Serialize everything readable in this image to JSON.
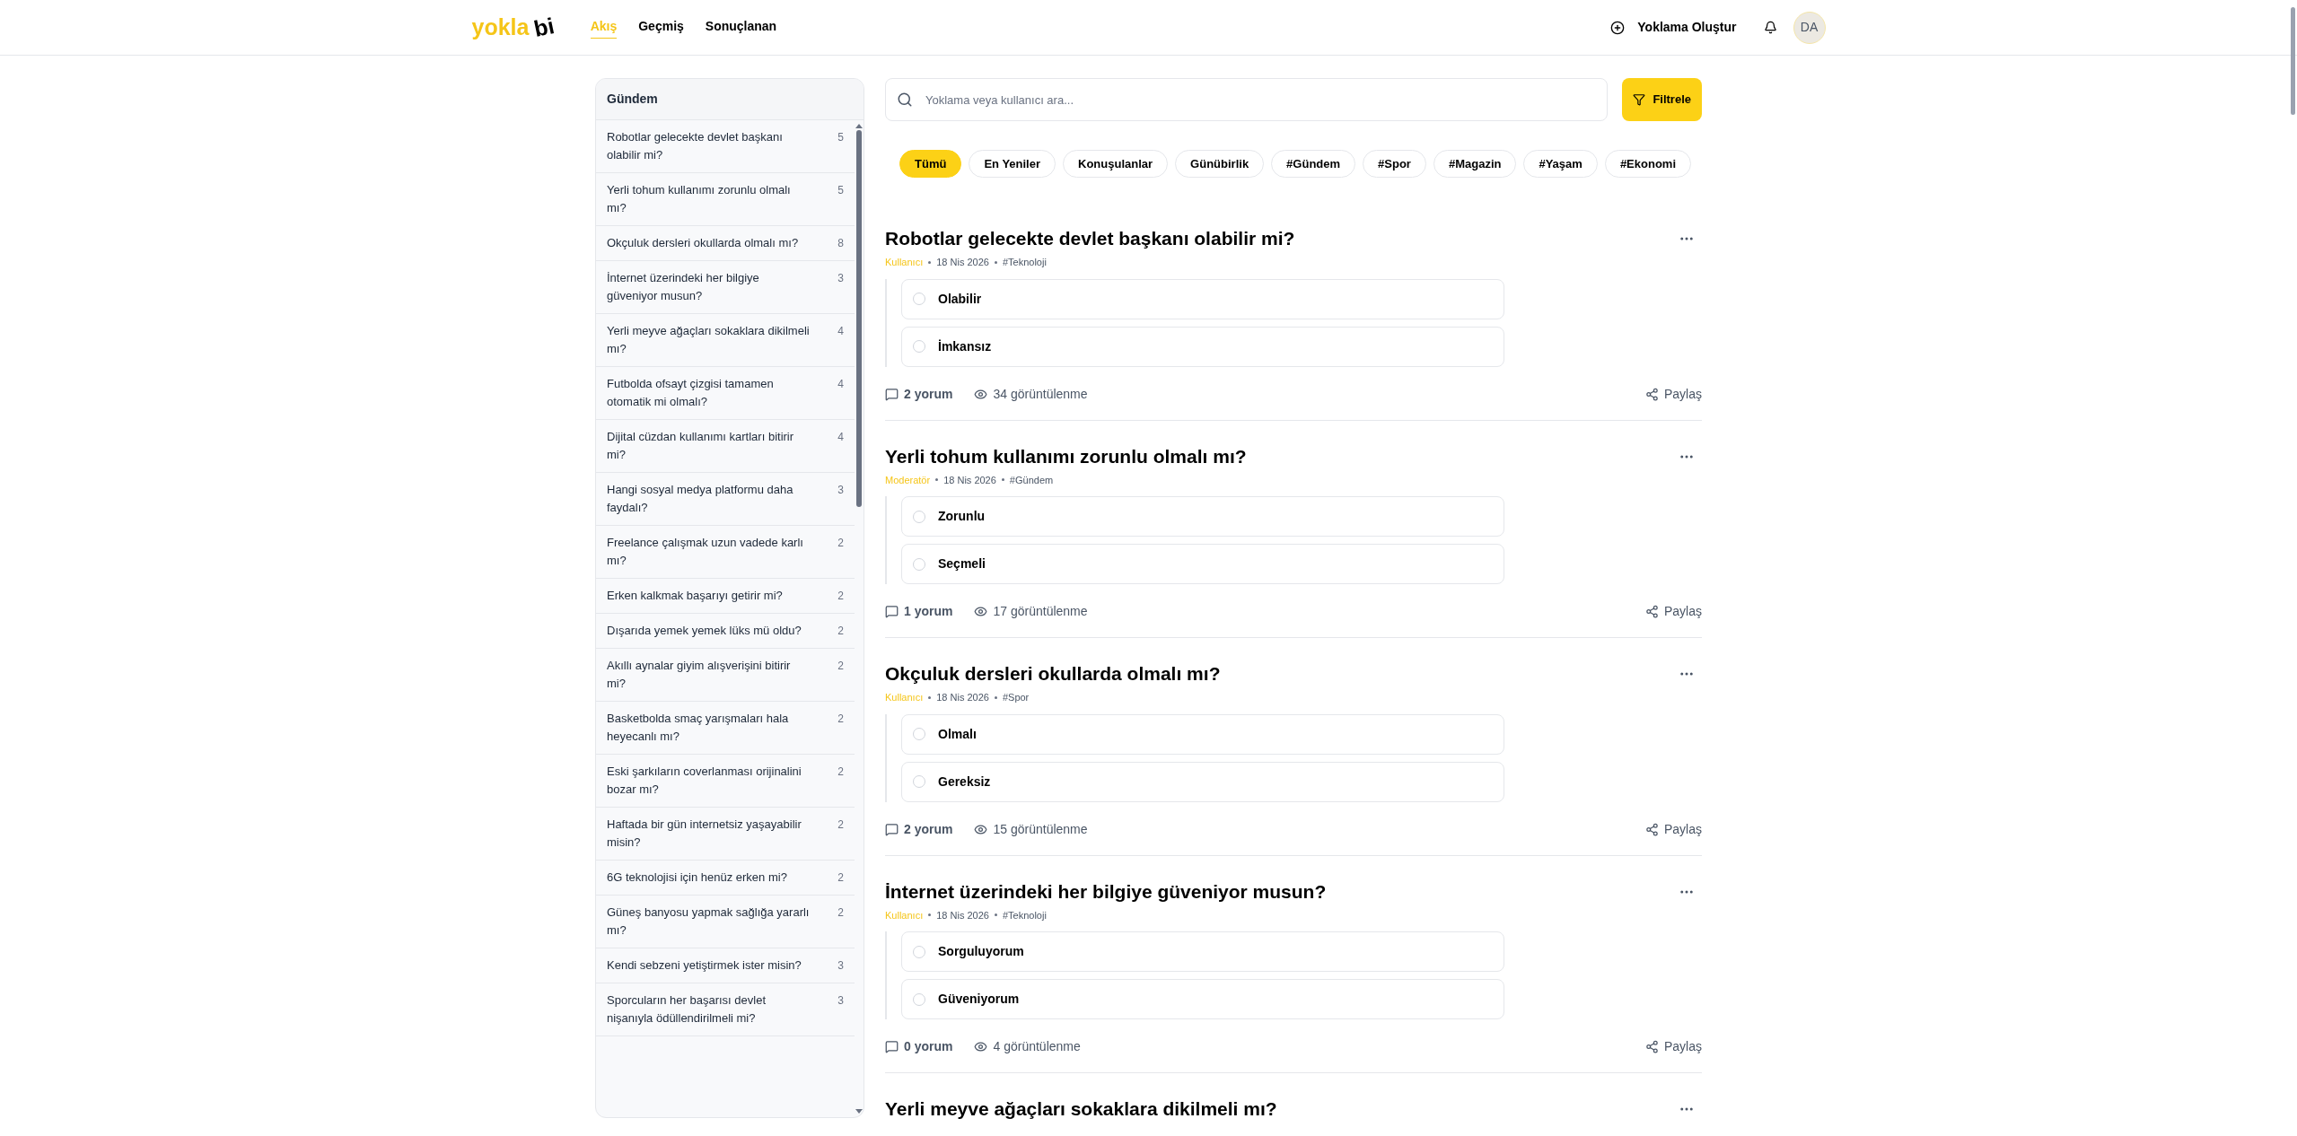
{
  "header": {
    "logo": {
      "part_1": "yokla",
      "part_2": "bi"
    },
    "nav": [
      {
        "label": "Akış",
        "selected": true
      },
      {
        "label": "Geçmiş",
        "selected": false
      },
      {
        "label": "Sonuçlanan",
        "selected": false
      }
    ],
    "create_button": "Yoklama Oluştur",
    "avatar": "DA"
  },
  "sidebar": {
    "title": "Gündem",
    "items": [
      {
        "text": "Robotlar gelecekte devlet başkanı olabilir mi?",
        "count": "5"
      },
      {
        "text": "Yerli tohum kullanımı zorunlu olmalı mı?",
        "count": "5"
      },
      {
        "text": "Okçuluk dersleri okullarda olmalı mı?",
        "count": "8"
      },
      {
        "text": "İnternet üzerindeki her bilgiye güveniyor musun?",
        "count": "3"
      },
      {
        "text": "Yerli meyve ağaçları sokaklara dikilmeli mı?",
        "count": "4"
      },
      {
        "text": "Futbolda ofsayt çizgisi tamamen otomatik mi olmalı?",
        "count": "4"
      },
      {
        "text": "Dijital cüzdan kullanımı kartları bitirir mi?",
        "count": "4"
      },
      {
        "text": "Hangi sosyal medya platformu daha faydalı?",
        "count": "3"
      },
      {
        "text": "Freelance çalışmak uzun vadede karlı mı?",
        "count": "2"
      },
      {
        "text": "Erken kalkmak başarıyı getirir mi?",
        "count": "2"
      },
      {
        "text": "Dışarıda yemek yemek lüks mü oldu?",
        "count": "2"
      },
      {
        "text": "Akıllı aynalar giyim alışverişini bitirir mi?",
        "count": "2"
      },
      {
        "text": "Basketbolda smaç yarışmaları hala heyecanlı mı?",
        "count": "2"
      },
      {
        "text": "Eski şarkıların coverlanması orijinalini bozar mı?",
        "count": "2"
      },
      {
        "text": "Haftada bir gün internetsiz yaşayabilir misin?",
        "count": "2"
      },
      {
        "text": "6G teknolojisi için henüz erken mi?",
        "count": "2"
      },
      {
        "text": "Güneş banyosu yapmak sağlığa yararlı mı?",
        "count": "2"
      },
      {
        "text": "Kendi sebzeni yetiştirmek ister misin?",
        "count": "3"
      },
      {
        "text": "Sporcuların her başarısı devlet nişanıyla ödüllendirilmeli mi?",
        "count": "3"
      }
    ]
  },
  "search": {
    "placeholder": "Yoklama veya kullanıcı ara..."
  },
  "filter_button": "Filtrele",
  "chips": [
    {
      "label": "Tümü",
      "selected": true
    },
    {
      "label": "En Yeniler",
      "selected": false
    },
    {
      "label": "Konuşulanlar",
      "selected": false
    },
    {
      "label": "Günübirlik",
      "selected": false
    },
    {
      "label": "#Gündem",
      "selected": false
    },
    {
      "label": "#Spor",
      "selected": false
    },
    {
      "label": "#Magazin",
      "selected": false
    },
    {
      "label": "#Yaşam",
      "selected": false
    },
    {
      "label": "#Ekonomi",
      "selected": false
    }
  ],
  "posts": [
    {
      "title": "Robotlar gelecekte devlet başkanı olabilir mi?",
      "author": "Kullanıcı",
      "date": "18 Nis 2026",
      "tag": "#Teknoloji",
      "options": [
        {
          "label": "Olabilir",
          "selected": false
        },
        {
          "label": "İmkansız",
          "selected": false
        }
      ],
      "comments": "2 yorum",
      "views": "34 görüntülenme",
      "share": "Paylaş"
    },
    {
      "title": "Yerli tohum kullanımı zorunlu olmalı mı?",
      "author": "Moderatör",
      "date": "18 Nis 2026",
      "tag": "#Gündem",
      "options": [
        {
          "label": "Zorunlu",
          "selected": false
        },
        {
          "label": "Seçmeli",
          "selected": false
        }
      ],
      "comments": "1 yorum",
      "views": "17 görüntülenme",
      "share": "Paylaş"
    },
    {
      "title": "Okçuluk dersleri okullarda olmalı mı?",
      "author": "Kullanıcı",
      "date": "18 Nis 2026",
      "tag": "#Spor",
      "options": [
        {
          "label": "Olmalı",
          "selected": false
        },
        {
          "label": "Gereksiz",
          "selected": false
        }
      ],
      "comments": "2 yorum",
      "views": "15 görüntülenme",
      "share": "Paylaş"
    },
    {
      "title": "İnternet üzerindeki her bilgiye güveniyor musun?",
      "author": "Kullanıcı",
      "date": "18 Nis 2026",
      "tag": "#Teknoloji",
      "options": [
        {
          "label": "Sorguluyorum",
          "selected": false
        },
        {
          "label": "Güveniyorum",
          "selected": false
        }
      ],
      "comments": "0 yorum",
      "views": "4 görüntülenme",
      "share": "Paylaş"
    },
    {
      "title": "Yerli meyve ağaçları sokaklara dikilmeli mı?"
    }
  ]
}
